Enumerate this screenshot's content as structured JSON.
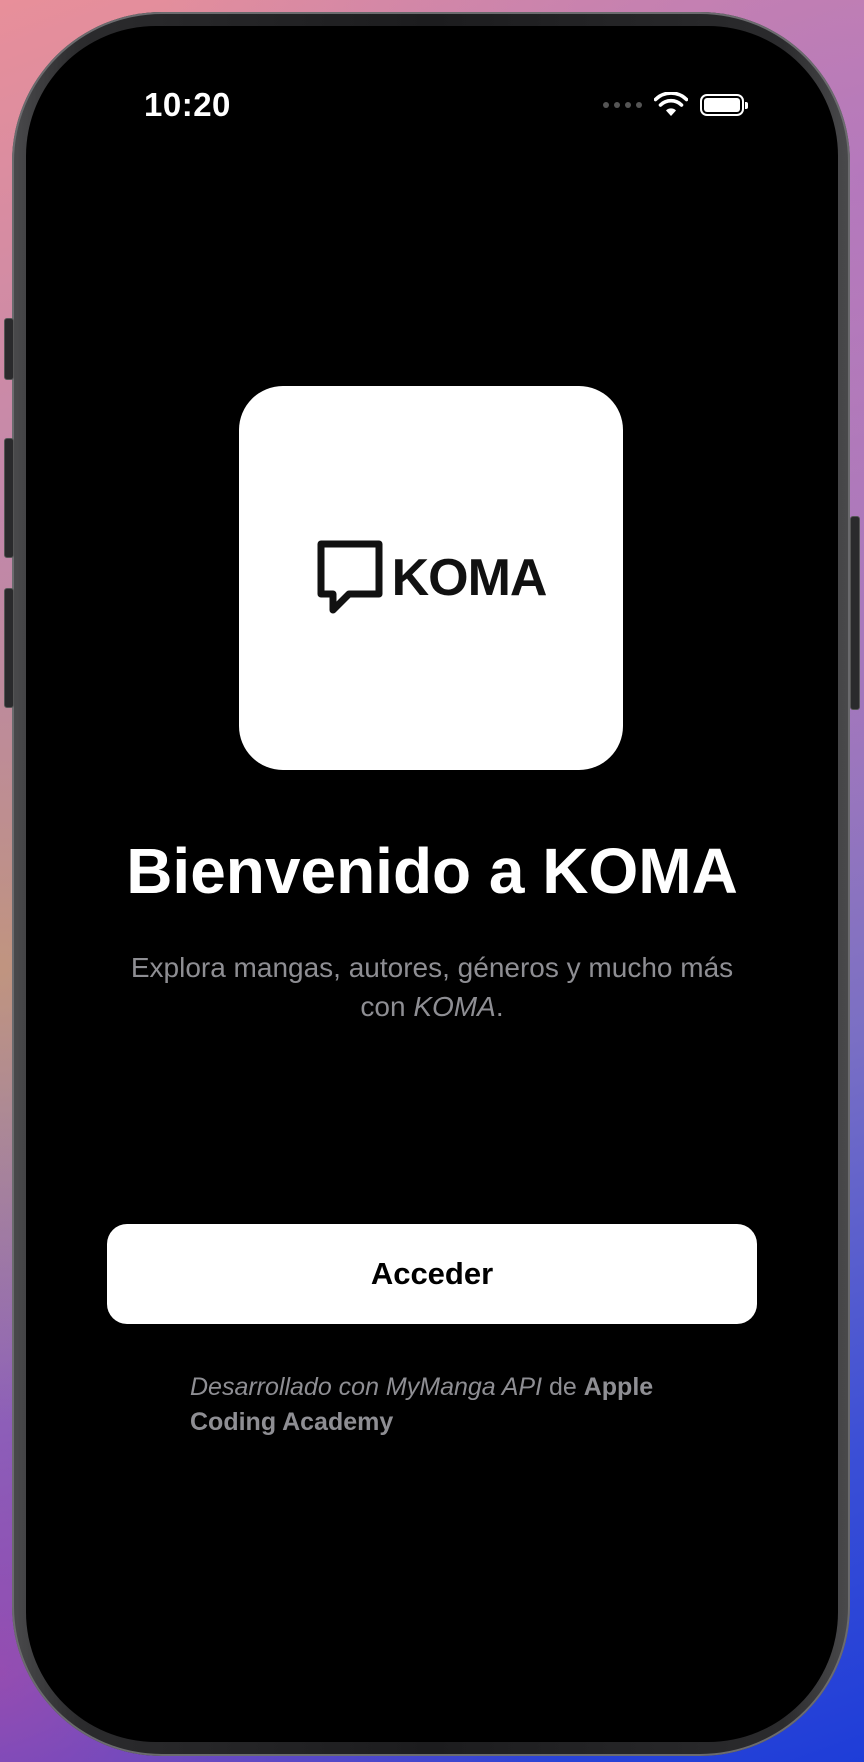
{
  "status_bar": {
    "time": "10:20",
    "icons": [
      "cellular-signal-icon",
      "wifi-icon",
      "battery-icon"
    ]
  },
  "logo": {
    "icon": "speech-bubble-icon",
    "wordmark": "KOMA"
  },
  "welcome": {
    "title": "Bienvenido a KOMA",
    "subtitle_prefix": "Explora mangas, autores, géneros y mucho más con ",
    "subtitle_app": "KOMA",
    "subtitle_suffix": "."
  },
  "actions": {
    "access_label": "Acceder"
  },
  "footer": {
    "developed_with": "Desarrollado con MyManga API",
    "connector": " de ",
    "author": "Apple Coding Academy"
  },
  "colors": {
    "background": "#000000",
    "card": "#ffffff",
    "secondary_text": "#8e8e93"
  }
}
